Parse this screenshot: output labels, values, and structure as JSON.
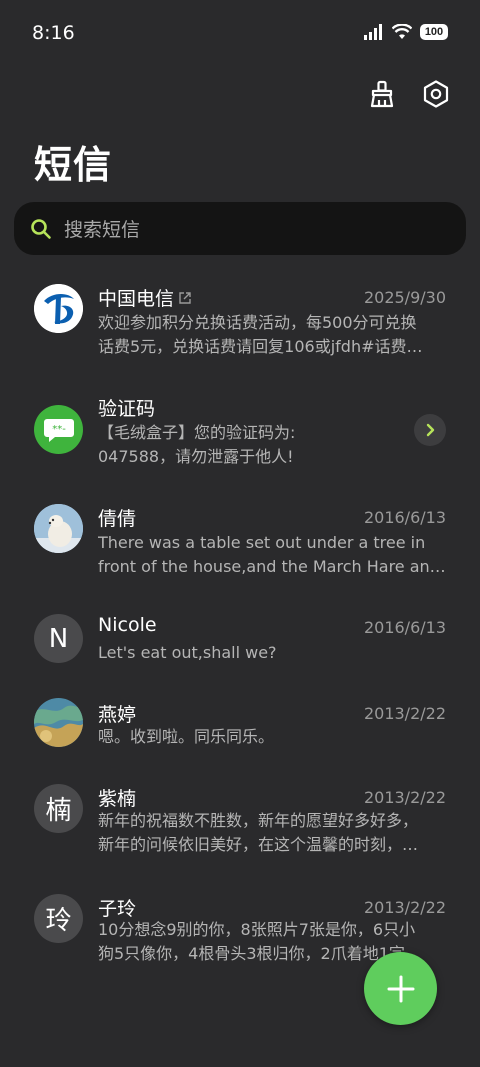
{
  "status_bar": {
    "time": "8:16",
    "battery": "100"
  },
  "header": {
    "title": "短信",
    "clean_icon": "broom-icon",
    "settings_icon": "settings-hexagon-icon"
  },
  "search": {
    "placeholder": "搜索短信"
  },
  "accent_color": "#5fcd5d",
  "messages": [
    {
      "name": "中国电信",
      "date": "2025/9/30",
      "line1": "欢迎参加积分兑换话费活动，每500分可兑换",
      "line2": "话费5元，兑换话费请回复106或jfdh#话费…"
    },
    {
      "name": "验证码",
      "date": "",
      "line1": "【毛绒盒子】您的验证码为:",
      "line2": "047588，请勿泄露于他人!"
    },
    {
      "name": "倩倩",
      "date": "2016/6/13",
      "line1": "There was a table set out under a tree in",
      "line2": "front of the house,and the March Hare an…"
    },
    {
      "name": "Nicole",
      "date": "2016/6/13",
      "line1": "Let's eat out,shall we?",
      "line2": "",
      "avatar": "N"
    },
    {
      "name": "燕婷",
      "date": "2013/2/22",
      "line1": "嗯。收到啦。同乐同乐。",
      "line2": ""
    },
    {
      "name": "紫楠",
      "date": "2013/2/22",
      "line1": "新年的祝福数不胜数，新年的愿望好多好多，",
      "line2": "新年的问候依旧美好，在这个温馨的时刻，…",
      "avatar": "楠"
    },
    {
      "name": "子玲",
      "date": "2013/2/22",
      "line1": "10分想念9别的你，8张照片7张是你，6只小",
      "line2": "狗5只像你，4根骨头3根归你，2爪着地1宗…",
      "avatar": "玲"
    }
  ]
}
